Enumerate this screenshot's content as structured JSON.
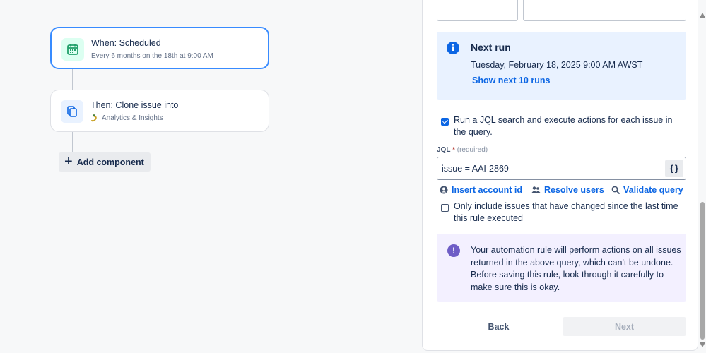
{
  "flow": {
    "trigger": {
      "title": "When: Scheduled",
      "subtitle": "Every 6 months on the 18th at 9:00 AM",
      "icon": "calendar-icon"
    },
    "action": {
      "title": "Then: Clone issue into",
      "subtitle": "Analytics & Insights",
      "icon": "copy-icon",
      "project_icon": "snake-project-icon"
    },
    "add_component_label": "Add component"
  },
  "panel": {
    "next_run": {
      "title": "Next run",
      "date": "Tuesday, February 18, 2025 9:00 AM AWST",
      "show_more_link": "Show next 10 runs"
    },
    "jql_checkbox": {
      "checked": true,
      "label": "Run a JQL search and execute actions for each issue in the query."
    },
    "jql": {
      "label": "JQL",
      "required_mark": "*",
      "required_text": "(required)",
      "value": "issue = AAI-2869",
      "syntax_button": "{}"
    },
    "links": {
      "insert_account": "Insert account id",
      "resolve_users": "Resolve users",
      "validate_query": "Validate query"
    },
    "changed_checkbox": {
      "checked": false,
      "label": "Only include issues that have changed since the last time this rule executed"
    },
    "warning": {
      "icon_text": "!",
      "text": "Your automation rule will perform actions on all issues returned in the above query, which can't be undone. Before saving this rule, look through it carefully to make sure this is okay."
    },
    "buttons": {
      "back": "Back",
      "next": "Next"
    }
  },
  "colors": {
    "accent": "#0c66e4",
    "selected_border": "#388bff",
    "info_bg": "#e9f2ff",
    "discovery_bg": "#f3f0ff",
    "discovery_icon": "#6e5dc6",
    "trigger_icon": "#22a06b"
  }
}
